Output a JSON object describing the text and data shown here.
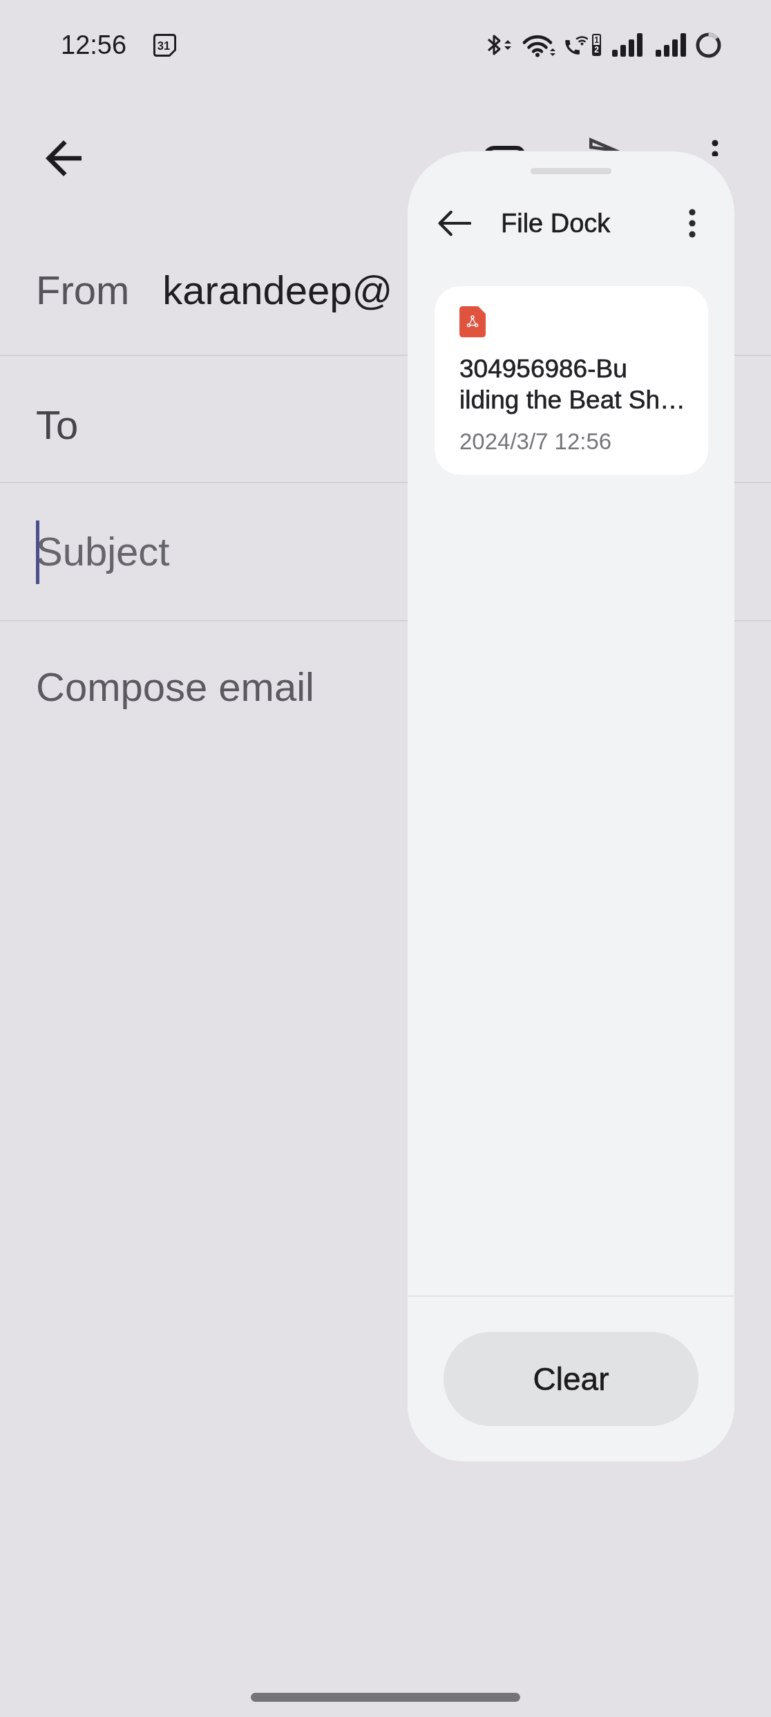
{
  "status_bar": {
    "time": "12:56",
    "calendar_day": "31",
    "sim_slots": [
      "1",
      "2"
    ]
  },
  "compose": {
    "fields": [
      {
        "kind": "from",
        "label": "From",
        "value": "karandeep@",
        "focused": false
      },
      {
        "kind": "to",
        "label": "To",
        "focused": false
      },
      {
        "kind": "subject",
        "placeholder": "Subject",
        "focused": true
      }
    ],
    "body": {
      "placeholder": "Compose email"
    }
  },
  "file_dock": {
    "title": "File Dock",
    "files": [
      {
        "kind": "pdf",
        "name_lines": [
          "304956986-Bu",
          "ilding the Beat Sh…"
        ],
        "date": "2024/3/7 12:56"
      }
    ],
    "clear_button": "Clear"
  }
}
